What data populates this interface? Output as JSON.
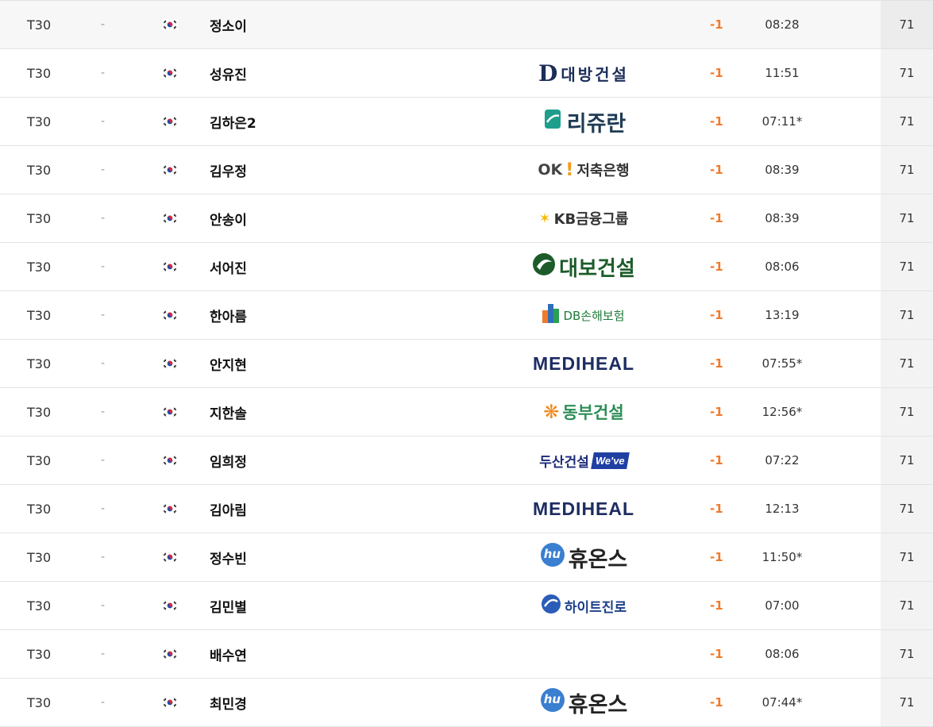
{
  "rows": [
    {
      "rank": "T30",
      "move": "-",
      "name": "정소이",
      "sponsor": null,
      "score": "-1",
      "time": "08:28",
      "total": "71"
    },
    {
      "rank": "T30",
      "move": "-",
      "name": "성유진",
      "sponsor": {
        "key": "daebang",
        "text": "대방건설",
        "mark": "D"
      },
      "score": "-1",
      "time": "11:51",
      "total": "71"
    },
    {
      "rank": "T30",
      "move": "-",
      "name": "김하은2",
      "sponsor": {
        "key": "ryo",
        "text": "리쥬란"
      },
      "score": "-1",
      "time": "07:11*",
      "total": "71"
    },
    {
      "rank": "T30",
      "move": "-",
      "name": "김우정",
      "sponsor": {
        "key": "ok",
        "text": "저축은행",
        "mark": "OK"
      },
      "score": "-1",
      "time": "08:39",
      "total": "71"
    },
    {
      "rank": "T30",
      "move": "-",
      "name": "안송이",
      "sponsor": {
        "key": "kb",
        "text": "KB금융그룹"
      },
      "score": "-1",
      "time": "08:39",
      "total": "71"
    },
    {
      "rank": "T30",
      "move": "-",
      "name": "서어진",
      "sponsor": {
        "key": "daebo",
        "text": "대보건설"
      },
      "score": "-1",
      "time": "08:06",
      "total": "71"
    },
    {
      "rank": "T30",
      "move": "-",
      "name": "한아름",
      "sponsor": {
        "key": "db",
        "text": "DB손해보험"
      },
      "score": "-1",
      "time": "13:19",
      "total": "71"
    },
    {
      "rank": "T30",
      "move": "-",
      "name": "안지현",
      "sponsor": {
        "key": "medi",
        "text": "MEDIHEAL"
      },
      "score": "-1",
      "time": "07:55*",
      "total": "71"
    },
    {
      "rank": "T30",
      "move": "-",
      "name": "지한솔",
      "sponsor": {
        "key": "dongbu",
        "text": "동부건설"
      },
      "score": "-1",
      "time": "12:56*",
      "total": "71"
    },
    {
      "rank": "T30",
      "move": "-",
      "name": "임희정",
      "sponsor": {
        "key": "doosan",
        "text": "두산건설",
        "badge": "We've"
      },
      "score": "-1",
      "time": "07:22",
      "total": "71"
    },
    {
      "rank": "T30",
      "move": "-",
      "name": "김아림",
      "sponsor": {
        "key": "medi",
        "text": "MEDIHEAL"
      },
      "score": "-1",
      "time": "12:13",
      "total": "71"
    },
    {
      "rank": "T30",
      "move": "-",
      "name": "정수빈",
      "sponsor": {
        "key": "huons",
        "text": "휴온스",
        "mark": "hu"
      },
      "score": "-1",
      "time": "11:50*",
      "total": "71"
    },
    {
      "rank": "T30",
      "move": "-",
      "name": "김민별",
      "sponsor": {
        "key": "hite",
        "text": "하이트진로"
      },
      "score": "-1",
      "time": "07:00",
      "total": "71"
    },
    {
      "rank": "T30",
      "move": "-",
      "name": "배수연",
      "sponsor": null,
      "score": "-1",
      "time": "08:06",
      "total": "71"
    },
    {
      "rank": "T30",
      "move": "-",
      "name": "최민경",
      "sponsor": {
        "key": "huons",
        "text": "휴온스",
        "mark": "hu"
      },
      "score": "-1",
      "time": "07:44*",
      "total": "71"
    }
  ],
  "flag_icon": "korea-flag-icon",
  "colors": {
    "score": "#f07a2c",
    "total_bg": "#f3f3f3",
    "first_row_bg": "#f7f7f7"
  }
}
